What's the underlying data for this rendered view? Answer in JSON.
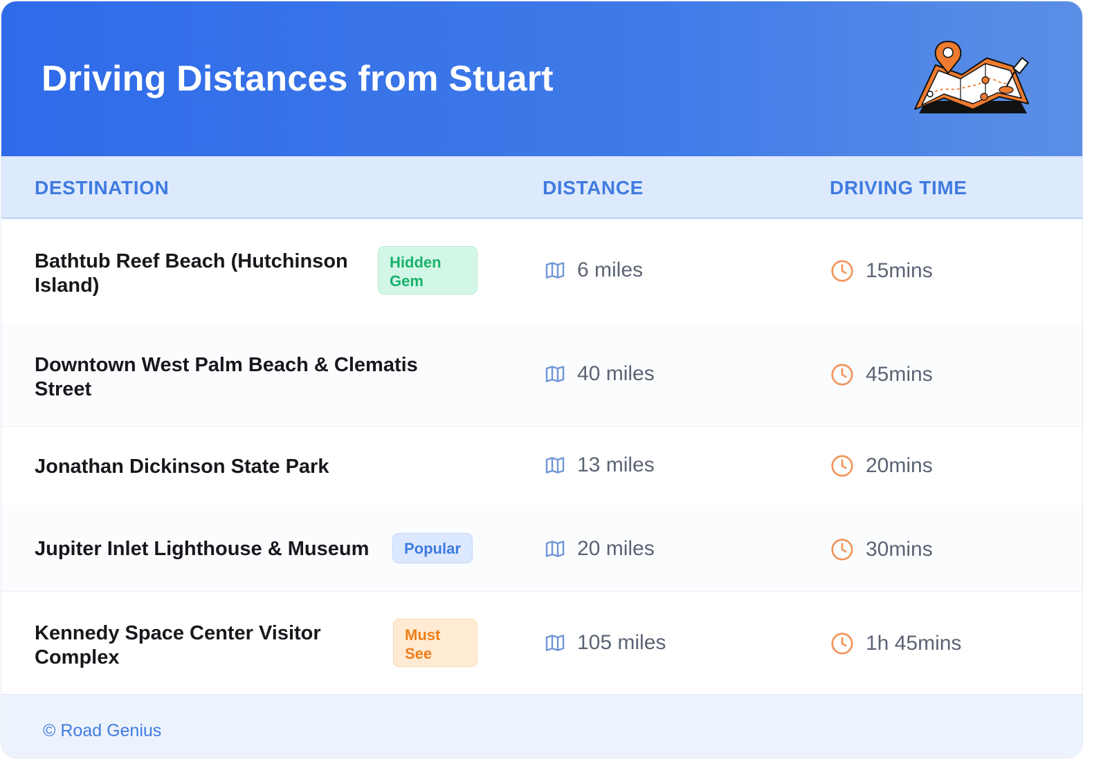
{
  "header": {
    "title": "Driving Distances from Stuart",
    "illustration_icon": "map-with-pin-icon"
  },
  "columns": {
    "destination": "DESTINATION",
    "distance": "DISTANCE",
    "driving_time": "DRIVING TIME"
  },
  "rows": [
    {
      "destination": "Bathtub Reef Beach (Hutchinson Island)",
      "badge": "Hidden Gem",
      "distance": "6 miles",
      "time": "15mins"
    },
    {
      "destination": "Downtown West Palm Beach & Clematis Street",
      "badge": "",
      "distance": "40 miles",
      "time": "45mins"
    },
    {
      "destination": "Jonathan Dickinson State Park",
      "badge": "",
      "distance": "13 miles",
      "time": "20mins"
    },
    {
      "destination": "Jupiter Inlet Lighthouse & Museum",
      "badge": "Popular",
      "distance": "20 miles",
      "time": "30mins"
    },
    {
      "destination": "Kennedy Space Center Visitor Complex",
      "badge": "Must See",
      "distance": "105 miles",
      "time": "1h 45mins"
    }
  ],
  "icons": {
    "distance": "map-icon",
    "time": "clock-icon"
  },
  "colors": {
    "header_start": "#2f6be9",
    "header_end": "#5b8fe6",
    "accent_blue": "#3f7be0",
    "badge_green": "#19b26b",
    "badge_orange": "#ef7d18",
    "clock_orange": "#f0955a"
  },
  "footer": {
    "text": "© Road Genius"
  }
}
